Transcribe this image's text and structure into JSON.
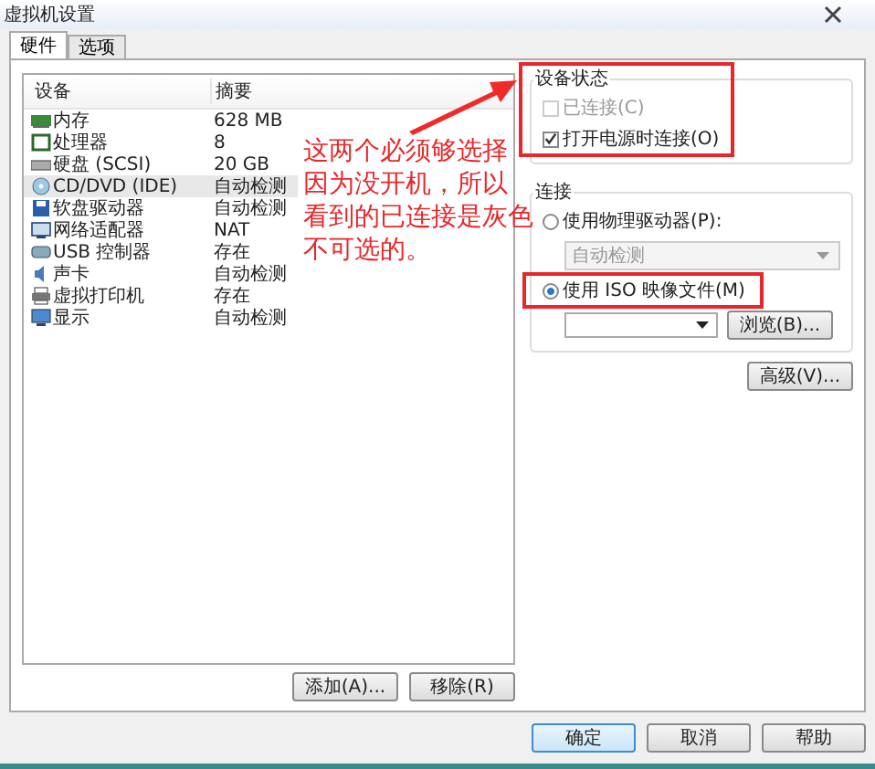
{
  "window": {
    "title": "虚拟机设置"
  },
  "tabs": [
    {
      "label": "硬件",
      "selected": true
    },
    {
      "label": "选项",
      "selected": false
    }
  ],
  "device_table": {
    "columns": [
      "设备",
      "摘要"
    ],
    "rows": [
      {
        "device": "内存",
        "summary": "628 MB",
        "selected": false
      },
      {
        "device": "处理器",
        "summary": "8",
        "selected": false
      },
      {
        "device": "硬盘 (SCSI)",
        "summary": "20 GB",
        "selected": false
      },
      {
        "device": "CD/DVD (IDE)",
        "summary": "自动检测",
        "selected": true
      },
      {
        "device": "软盘驱动器",
        "summary": "自动检测",
        "selected": false
      },
      {
        "device": "网络适配器",
        "summary": "NAT",
        "selected": false
      },
      {
        "device": "USB 控制器",
        "summary": "存在",
        "selected": false
      },
      {
        "device": "声卡",
        "summary": "自动检测",
        "selected": false
      },
      {
        "device": "虚拟打印机",
        "summary": "存在",
        "selected": false
      },
      {
        "device": "显示",
        "summary": "自动检测",
        "selected": false
      }
    ]
  },
  "device_buttons": [
    "添加(A)...",
    "移除(R)"
  ],
  "device_status": {
    "title": "设备状态",
    "options": [
      {
        "label": "已连接(C)",
        "checked": false,
        "disabled": true
      },
      {
        "label": "打开电源时连接(O)",
        "checked": true,
        "disabled": false
      }
    ]
  },
  "connection": {
    "title": "连接",
    "options": [
      {
        "label": "使用物理驱动器(P):",
        "selected": false
      },
      {
        "label": "使用 ISO 映像文件(M)",
        "selected": true
      }
    ],
    "drive_select": {
      "value": "自动检测",
      "disabled": true
    },
    "browse_button": "浏览(B)..."
  },
  "advanced_button": "高级(V)...",
  "dialog_buttons": [
    "确定",
    "取消",
    "帮助"
  ],
  "annotation": {
    "lines": [
      "这两个必须够选择",
      "因为没开机，所以",
      "看到的已连接是灰色",
      "不可选的。"
    ]
  }
}
